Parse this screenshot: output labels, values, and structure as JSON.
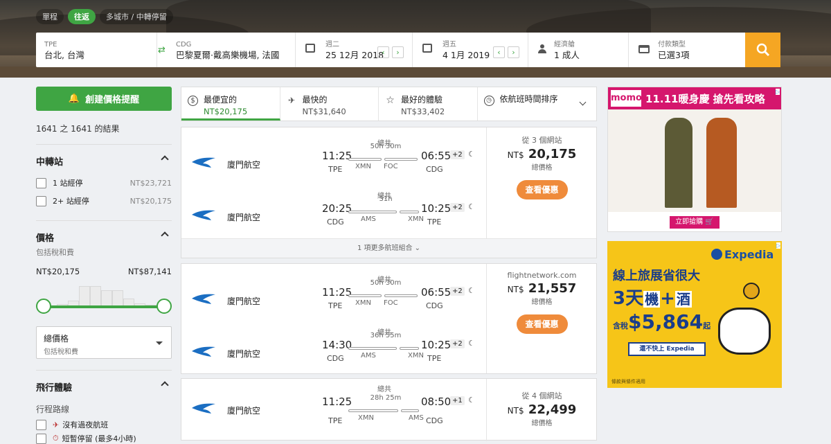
{
  "trip_types": [
    "單程",
    "往返",
    "多城市 / 中轉停留"
  ],
  "search": {
    "origin_code": "TPE",
    "origin_name": "台北, 台灣",
    "dest_code": "CDG",
    "dest_name": "巴黎夏爾·戴高樂機場, 法國",
    "depart_day": "週二",
    "depart_date": "25 12月 2018",
    "return_day": "週五",
    "return_date": "4 1月 2019",
    "cabin_label": "經濟艙",
    "passengers": "1 成人",
    "payment_label": "付款類型",
    "payment_value": "已選3項"
  },
  "sidebar": {
    "alert_button": "創建價格提醒",
    "result_count": "1641 之 1641 的結果",
    "stops_title": "中轉站",
    "stops": [
      {
        "label": "1 站經停",
        "price": "NT$23,721"
      },
      {
        "label": "2+ 站經停",
        "price": "NT$20,175"
      }
    ],
    "price_title": "價格",
    "price_sub": "包括稅和費",
    "price_min": "NT$20,175",
    "price_max": "NT$87,141",
    "select_title": "總價格",
    "select_sub": "包括稅和費",
    "exp_title": "飛行體驗",
    "route_label": "行程路線",
    "no_overnight": "沒有過夜航班",
    "short_layover": "短暫停留 (最多4小時)"
  },
  "sort": [
    {
      "label": "最便宜的",
      "price": "NT$20,175"
    },
    {
      "label": "最快的",
      "price": "NT$31,640"
    },
    {
      "label": "最好的體驗",
      "price": "NT$33,402"
    },
    {
      "label": "依航班時間排序",
      "price": ""
    }
  ],
  "results": [
    {
      "legs": [
        {
          "airline": "廈門航空",
          "dep": "11:25",
          "arr": "06:55",
          "plus": "+2",
          "total": "總共",
          "dur": "50h 30m",
          "from": "TPE",
          "to": "CDG",
          "stops": [
            "XMN",
            "FOC"
          ]
        },
        {
          "airline": "廈門航空",
          "dep": "20:25",
          "arr": "10:25",
          "plus": "+2",
          "total": "總共",
          "dur": "31h",
          "from": "CDG",
          "to": "TPE",
          "stops": [
            "AMS",
            "XMN"
          ]
        }
      ],
      "provider": "從 3 個網站",
      "price_currency": "NT$",
      "price": "20,175",
      "total_label": "總價格",
      "deal": "查看優惠",
      "more": "1 項更多航班組合"
    },
    {
      "legs": [
        {
          "airline": "廈門航空",
          "dep": "11:25",
          "arr": "06:55",
          "plus": "+2",
          "total": "總共",
          "dur": "50h 30m",
          "from": "TPE",
          "to": "CDG",
          "stops": [
            "XMN",
            "FOC"
          ]
        },
        {
          "airline": "廈門航空",
          "dep": "14:30",
          "arr": "10:25",
          "plus": "+2",
          "total": "總共",
          "dur": "36h 55m",
          "from": "CDG",
          "to": "TPE",
          "stops": [
            "AMS",
            "XMN"
          ]
        }
      ],
      "provider": "flightnetwork.com",
      "price_currency": "NT$",
      "price": "21,557",
      "total_label": "總價格",
      "deal": "查看優惠"
    },
    {
      "legs": [
        {
          "airline": "廈門航空",
          "dep": "11:25",
          "arr": "08:50",
          "plus": "+1",
          "total": "總共",
          "dur": "28h 25m",
          "from": "TPE",
          "to": "CDG",
          "stops": [
            "XMN",
            "AMS"
          ]
        }
      ],
      "provider": "從 4 個網站",
      "price_currency": "NT$",
      "price": "22,499",
      "total_label": "總價格"
    }
  ],
  "ads": {
    "momo_brand": "momo",
    "momo_headline": "11.11暖身慶  搶先看攻略",
    "momo_cta": "立即搶購",
    "expedia_brand": "Expedia",
    "expedia_line1": "線上旅展省很大",
    "expedia_line2a": "3天",
    "expedia_line2b": "機",
    "expedia_line2c": "+",
    "expedia_line2d": "酒",
    "expedia_tax": "含稅",
    "expedia_price": "$5,864",
    "expedia_from": "起",
    "expedia_cta": "還不快上 Expedia",
    "expedia_terms": "條款與條件適用"
  },
  "colors": {
    "brand_green": "#3fa543",
    "search_orange": "#f5a623",
    "deal_orange": "#ef8b3b",
    "expedia_yellow": "#f6c518",
    "expedia_blue": "#1a4fa3",
    "momo_pink": "#d5166d"
  }
}
